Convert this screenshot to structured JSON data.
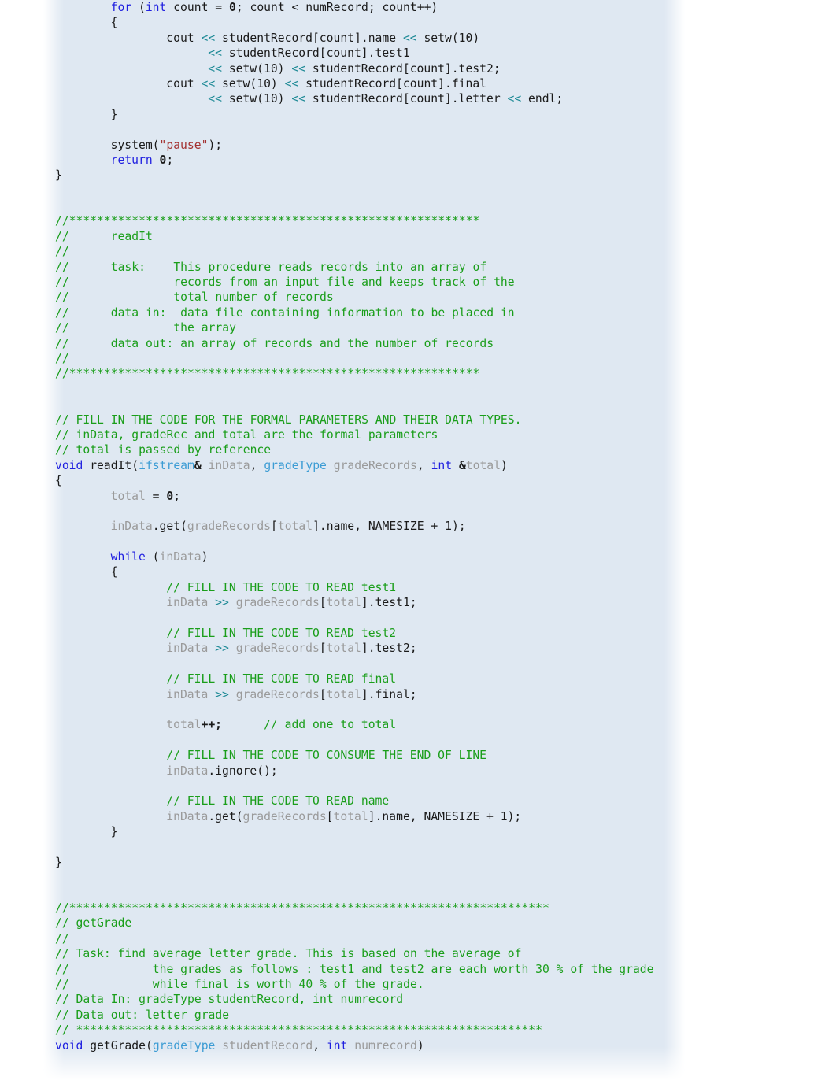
{
  "document": {
    "type": "cpp-source-listing",
    "language": "C++",
    "colors": {
      "panel_background": "#dfe8f2",
      "page_background": "#ffffff",
      "keyword": "#2020e0",
      "type": "#3c9cd4",
      "operator": "#1e8a96",
      "string": "#a33030",
      "comment": "#1a9e1a",
      "identifier": "#9a9a9a",
      "plain": "#1a1a1a"
    }
  },
  "code": {
    "lines": [
      {
        "i": 0,
        "indent": 8,
        "tokens": [
          {
            "t": "for",
            "c": "kw"
          },
          {
            "t": " (",
            "c": "pln"
          },
          {
            "t": "int",
            "c": "kw"
          },
          {
            "t": " count = ",
            "c": "pln"
          },
          {
            "t": "0",
            "c": "num"
          },
          {
            "t": "; count < numRecord; count++)",
            "c": "pln"
          }
        ]
      },
      {
        "i": 1,
        "indent": 8,
        "tokens": [
          {
            "t": "{",
            "c": "pln"
          }
        ]
      },
      {
        "i": 2,
        "indent": 16,
        "tokens": [
          {
            "t": "cout ",
            "c": "pln"
          },
          {
            "t": "<<",
            "c": "op"
          },
          {
            "t": " studentRecord[count].name ",
            "c": "pln"
          },
          {
            "t": "<<",
            "c": "op"
          },
          {
            "t": " setw(10)",
            "c": "pln"
          }
        ]
      },
      {
        "i": 3,
        "indent": 22,
        "tokens": [
          {
            "t": "<<",
            "c": "op"
          },
          {
            "t": " studentRecord[count].test1",
            "c": "pln"
          }
        ]
      },
      {
        "i": 4,
        "indent": 22,
        "tokens": [
          {
            "t": "<<",
            "c": "op"
          },
          {
            "t": " setw(10) ",
            "c": "pln"
          },
          {
            "t": "<<",
            "c": "op"
          },
          {
            "t": " studentRecord[count].test2;",
            "c": "pln"
          }
        ]
      },
      {
        "i": 5,
        "indent": 16,
        "tokens": [
          {
            "t": "cout ",
            "c": "pln"
          },
          {
            "t": "<<",
            "c": "op"
          },
          {
            "t": " setw(10) ",
            "c": "pln"
          },
          {
            "t": "<<",
            "c": "op"
          },
          {
            "t": " studentRecord[count].final",
            "c": "pln"
          }
        ]
      },
      {
        "i": 6,
        "indent": 22,
        "tokens": [
          {
            "t": "<<",
            "c": "op"
          },
          {
            "t": " setw(10) ",
            "c": "pln"
          },
          {
            "t": "<<",
            "c": "op"
          },
          {
            "t": " studentRecord[count].letter ",
            "c": "pln"
          },
          {
            "t": "<<",
            "c": "op"
          },
          {
            "t": " endl;",
            "c": "pln"
          }
        ]
      },
      {
        "i": 7,
        "indent": 8,
        "tokens": [
          {
            "t": "}",
            "c": "pln"
          }
        ]
      },
      {
        "i": 8,
        "indent": 0,
        "tokens": []
      },
      {
        "i": 9,
        "indent": 8,
        "tokens": [
          {
            "t": "system(",
            "c": "pln"
          },
          {
            "t": "\"pause\"",
            "c": "str"
          },
          {
            "t": ");",
            "c": "pln"
          }
        ]
      },
      {
        "i": 10,
        "indent": 8,
        "tokens": [
          {
            "t": "return",
            "c": "kw"
          },
          {
            "t": " ",
            "c": "pln"
          },
          {
            "t": "0",
            "c": "num"
          },
          {
            "t": ";",
            "c": "pln"
          }
        ]
      },
      {
        "i": 11,
        "indent": 0,
        "tokens": [
          {
            "t": "}",
            "c": "pln"
          }
        ]
      },
      {
        "i": 12,
        "indent": 0,
        "tokens": []
      },
      {
        "i": 13,
        "indent": 0,
        "tokens": []
      },
      {
        "i": 14,
        "indent": 0,
        "tokens": [
          {
            "t": "//***********************************************************",
            "c": "cmt"
          }
        ]
      },
      {
        "i": 15,
        "indent": 0,
        "tokens": [
          {
            "t": "//      readIt",
            "c": "cmt"
          }
        ]
      },
      {
        "i": 16,
        "indent": 0,
        "tokens": [
          {
            "t": "//",
            "c": "cmt"
          }
        ]
      },
      {
        "i": 17,
        "indent": 0,
        "tokens": [
          {
            "t": "//      task:    This procedure reads records into an array of",
            "c": "cmt"
          }
        ]
      },
      {
        "i": 18,
        "indent": 0,
        "tokens": [
          {
            "t": "//               records from an input file and keeps track of the",
            "c": "cmt"
          }
        ]
      },
      {
        "i": 19,
        "indent": 0,
        "tokens": [
          {
            "t": "//               total number of records",
            "c": "cmt"
          }
        ]
      },
      {
        "i": 20,
        "indent": 0,
        "tokens": [
          {
            "t": "//      data in:  data file containing information to be placed in",
            "c": "cmt"
          }
        ]
      },
      {
        "i": 21,
        "indent": 0,
        "tokens": [
          {
            "t": "//               the array",
            "c": "cmt"
          }
        ]
      },
      {
        "i": 22,
        "indent": 0,
        "tokens": [
          {
            "t": "//      data out: an array of records and the number of records",
            "c": "cmt"
          }
        ]
      },
      {
        "i": 23,
        "indent": 0,
        "tokens": [
          {
            "t": "//",
            "c": "cmt"
          }
        ]
      },
      {
        "i": 24,
        "indent": 0,
        "tokens": [
          {
            "t": "//***********************************************************",
            "c": "cmt"
          }
        ]
      },
      {
        "i": 25,
        "indent": 0,
        "tokens": []
      },
      {
        "i": 26,
        "indent": 0,
        "tokens": []
      },
      {
        "i": 27,
        "indent": 0,
        "tokens": [
          {
            "t": "// FILL IN THE CODE FOR THE FORMAL PARAMETERS AND THEIR DATA TYPES.",
            "c": "cmt"
          }
        ]
      },
      {
        "i": 28,
        "indent": 0,
        "tokens": [
          {
            "t": "// inData, gradeRec and total are the formal parameters",
            "c": "cmt"
          }
        ]
      },
      {
        "i": 29,
        "indent": 0,
        "tokens": [
          {
            "t": "// total is passed by reference",
            "c": "cmt"
          }
        ]
      },
      {
        "i": 30,
        "indent": 0,
        "tokens": [
          {
            "t": "void",
            "c": "kw"
          },
          {
            "t": " readIt(",
            "c": "pln"
          },
          {
            "t": "ifstream",
            "c": "typ"
          },
          {
            "t": "&",
            "c": "bld"
          },
          {
            "t": " ",
            "c": "pln"
          },
          {
            "t": "inData",
            "c": "id"
          },
          {
            "t": ", ",
            "c": "pln"
          },
          {
            "t": "gradeType",
            "c": "typ"
          },
          {
            "t": " ",
            "c": "pln"
          },
          {
            "t": "gradeRecords",
            "c": "id"
          },
          {
            "t": ", ",
            "c": "pln"
          },
          {
            "t": "int",
            "c": "kw"
          },
          {
            "t": " ",
            "c": "pln"
          },
          {
            "t": "&",
            "c": "bld"
          },
          {
            "t": "total",
            "c": "id"
          },
          {
            "t": ")",
            "c": "pln"
          }
        ]
      },
      {
        "i": 31,
        "indent": 0,
        "tokens": [
          {
            "t": "{",
            "c": "pln"
          }
        ]
      },
      {
        "i": 32,
        "indent": 8,
        "tokens": [
          {
            "t": "total",
            "c": "id"
          },
          {
            "t": " = ",
            "c": "pln"
          },
          {
            "t": "0",
            "c": "num"
          },
          {
            "t": ";",
            "c": "pln"
          }
        ]
      },
      {
        "i": 33,
        "indent": 0,
        "tokens": []
      },
      {
        "i": 34,
        "indent": 8,
        "tokens": [
          {
            "t": "inData",
            "c": "id"
          },
          {
            "t": ".get(",
            "c": "pln"
          },
          {
            "t": "gradeRecords",
            "c": "id"
          },
          {
            "t": "[",
            "c": "pln"
          },
          {
            "t": "total",
            "c": "id"
          },
          {
            "t": "].name, NAMESIZE + 1);",
            "c": "pln"
          }
        ]
      },
      {
        "i": 35,
        "indent": 0,
        "tokens": []
      },
      {
        "i": 36,
        "indent": 8,
        "tokens": [
          {
            "t": "while",
            "c": "kw"
          },
          {
            "t": " (",
            "c": "pln"
          },
          {
            "t": "inData",
            "c": "id"
          },
          {
            "t": ")",
            "c": "pln"
          }
        ]
      },
      {
        "i": 37,
        "indent": 8,
        "tokens": [
          {
            "t": "{",
            "c": "pln"
          }
        ]
      },
      {
        "i": 38,
        "indent": 16,
        "tokens": [
          {
            "t": "// FILL IN THE CODE TO READ test1",
            "c": "cmt"
          }
        ]
      },
      {
        "i": 39,
        "indent": 16,
        "tokens": [
          {
            "t": "inData",
            "c": "id"
          },
          {
            "t": " ",
            "c": "pln"
          },
          {
            "t": ">>",
            "c": "op"
          },
          {
            "t": " ",
            "c": "pln"
          },
          {
            "t": "gradeRecords",
            "c": "id"
          },
          {
            "t": "[",
            "c": "pln"
          },
          {
            "t": "total",
            "c": "id"
          },
          {
            "t": "].test1;",
            "c": "pln"
          }
        ]
      },
      {
        "i": 40,
        "indent": 0,
        "tokens": []
      },
      {
        "i": 41,
        "indent": 16,
        "tokens": [
          {
            "t": "// FILL IN THE CODE TO READ test2",
            "c": "cmt"
          }
        ]
      },
      {
        "i": 42,
        "indent": 16,
        "tokens": [
          {
            "t": "inData",
            "c": "id"
          },
          {
            "t": " ",
            "c": "pln"
          },
          {
            "t": ">>",
            "c": "op"
          },
          {
            "t": " ",
            "c": "pln"
          },
          {
            "t": "gradeRecords",
            "c": "id"
          },
          {
            "t": "[",
            "c": "pln"
          },
          {
            "t": "total",
            "c": "id"
          },
          {
            "t": "].test2;",
            "c": "pln"
          }
        ]
      },
      {
        "i": 43,
        "indent": 0,
        "tokens": []
      },
      {
        "i": 44,
        "indent": 16,
        "tokens": [
          {
            "t": "// FILL IN THE CODE TO READ final",
            "c": "cmt"
          }
        ]
      },
      {
        "i": 45,
        "indent": 16,
        "tokens": [
          {
            "t": "inData",
            "c": "id"
          },
          {
            "t": " ",
            "c": "pln"
          },
          {
            "t": ">>",
            "c": "op"
          },
          {
            "t": " ",
            "c": "pln"
          },
          {
            "t": "gradeRecords",
            "c": "id"
          },
          {
            "t": "[",
            "c": "pln"
          },
          {
            "t": "total",
            "c": "id"
          },
          {
            "t": "].final;",
            "c": "pln"
          }
        ]
      },
      {
        "i": 46,
        "indent": 0,
        "tokens": []
      },
      {
        "i": 47,
        "indent": 16,
        "tokens": [
          {
            "t": "total",
            "c": "id"
          },
          {
            "t": "++;",
            "c": "bld"
          },
          {
            "t": "      ",
            "c": "pln"
          },
          {
            "t": "// add one to total",
            "c": "cmt"
          }
        ]
      },
      {
        "i": 48,
        "indent": 0,
        "tokens": []
      },
      {
        "i": 49,
        "indent": 16,
        "tokens": [
          {
            "t": "// FILL IN THE CODE TO CONSUME THE END OF LINE",
            "c": "cmt"
          }
        ]
      },
      {
        "i": 50,
        "indent": 16,
        "tokens": [
          {
            "t": "inData",
            "c": "id"
          },
          {
            "t": ".ignore();",
            "c": "pln"
          }
        ]
      },
      {
        "i": 51,
        "indent": 0,
        "tokens": []
      },
      {
        "i": 52,
        "indent": 16,
        "tokens": [
          {
            "t": "// FILL IN THE CODE TO READ name",
            "c": "cmt"
          }
        ]
      },
      {
        "i": 53,
        "indent": 16,
        "tokens": [
          {
            "t": "inData",
            "c": "id"
          },
          {
            "t": ".get(",
            "c": "pln"
          },
          {
            "t": "gradeRecords",
            "c": "id"
          },
          {
            "t": "[",
            "c": "pln"
          },
          {
            "t": "total",
            "c": "id"
          },
          {
            "t": "].name, NAMESIZE + 1);",
            "c": "pln"
          }
        ]
      },
      {
        "i": 54,
        "indent": 8,
        "tokens": [
          {
            "t": "}",
            "c": "pln"
          }
        ]
      },
      {
        "i": 55,
        "indent": 0,
        "tokens": []
      },
      {
        "i": 56,
        "indent": 0,
        "tokens": [
          {
            "t": "}",
            "c": "pln"
          }
        ]
      },
      {
        "i": 57,
        "indent": 0,
        "tokens": []
      },
      {
        "i": 58,
        "indent": 0,
        "tokens": []
      },
      {
        "i": 59,
        "indent": 0,
        "tokens": [
          {
            "t": "//*********************************************************************",
            "c": "cmt"
          }
        ]
      },
      {
        "i": 60,
        "indent": 0,
        "tokens": [
          {
            "t": "// getGrade",
            "c": "cmt"
          }
        ]
      },
      {
        "i": 61,
        "indent": 0,
        "tokens": [
          {
            "t": "//",
            "c": "cmt"
          }
        ]
      },
      {
        "i": 62,
        "indent": 0,
        "tokens": [
          {
            "t": "// Task: find average letter grade. This is based on the average of",
            "c": "cmt"
          }
        ]
      },
      {
        "i": 63,
        "indent": 0,
        "tokens": [
          {
            "t": "//            the grades as follows : test1 and test2 are each worth 30 % of the grade",
            "c": "cmt"
          }
        ]
      },
      {
        "i": 64,
        "indent": 0,
        "tokens": [
          {
            "t": "//            while final is worth 40 % of the grade.",
            "c": "cmt"
          }
        ]
      },
      {
        "i": 65,
        "indent": 0,
        "tokens": [
          {
            "t": "// Data In: gradeType studentRecord, int numrecord",
            "c": "cmt"
          }
        ]
      },
      {
        "i": 66,
        "indent": 0,
        "tokens": [
          {
            "t": "// Data out: letter grade",
            "c": "cmt"
          }
        ]
      },
      {
        "i": 67,
        "indent": 0,
        "tokens": [
          {
            "t": "// *******************************************************************",
            "c": "cmt"
          }
        ]
      },
      {
        "i": 68,
        "indent": 0,
        "tokens": [
          {
            "t": "void",
            "c": "kw"
          },
          {
            "t": " getGrade(",
            "c": "pln"
          },
          {
            "t": "gradeType",
            "c": "typ"
          },
          {
            "t": " ",
            "c": "pln"
          },
          {
            "t": "studentRecord",
            "c": "id"
          },
          {
            "t": ", ",
            "c": "pln"
          },
          {
            "t": "int",
            "c": "kw"
          },
          {
            "t": " ",
            "c": "pln"
          },
          {
            "t": "numrecord",
            "c": "id"
          },
          {
            "t": ")",
            "c": "pln"
          }
        ]
      }
    ]
  }
}
